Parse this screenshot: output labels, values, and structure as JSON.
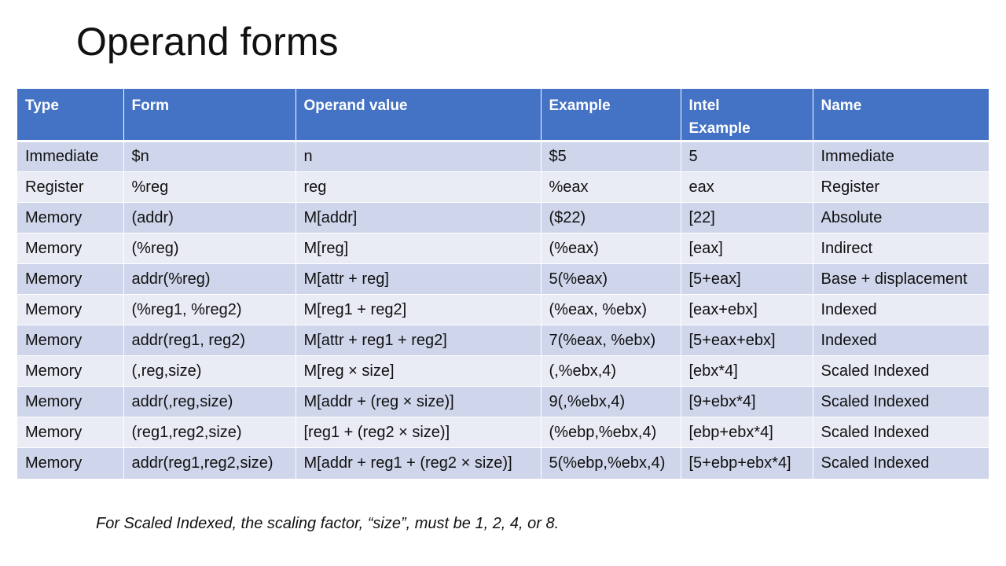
{
  "slide": {
    "title": "Operand forms",
    "footnote": "For Scaled Indexed, the scaling factor, “size”, must be 1, 2, 4, or 8."
  },
  "table": {
    "headers": [
      "Type",
      "Form",
      "Operand value",
      "Example",
      "Intel\nExample",
      "Name"
    ],
    "rows": [
      [
        "Immediate",
        "$n",
        "n",
        "$5",
        "5",
        "Immediate"
      ],
      [
        "Register",
        "%reg",
        "reg",
        "%eax",
        "eax",
        "Register"
      ],
      [
        "Memory",
        "(addr)",
        "M[addr]",
        "($22)",
        "[22]",
        "Absolute"
      ],
      [
        "Memory",
        "(%reg)",
        "M[reg]",
        "(%eax)",
        "[eax]",
        "Indirect"
      ],
      [
        "Memory",
        "addr(%reg)",
        "M[attr + reg]",
        "5(%eax)",
        "[5+eax]",
        "Base + displacement"
      ],
      [
        "Memory",
        "(%reg1, %reg2)",
        "M[reg1 + reg2]",
        "(%eax, %ebx)",
        "[eax+ebx]",
        "Indexed"
      ],
      [
        "Memory",
        "addr(reg1, reg2)",
        "M[attr + reg1 + reg2]",
        "7(%eax, %ebx)",
        "[5+eax+ebx]",
        "Indexed"
      ],
      [
        "Memory",
        "(,reg,size)",
        "M[reg × size]",
        "(,%ebx,4)",
        "[ebx*4]",
        "Scaled Indexed"
      ],
      [
        "Memory",
        "addr(,reg,size)",
        "M[addr + (reg × size)]",
        "9(,%ebx,4)",
        "[9+ebx*4]",
        "Scaled Indexed"
      ],
      [
        "Memory",
        "(reg1,reg2,size)",
        "[reg1 + (reg2 × size)]",
        "(%ebp,%ebx,4)",
        "[ebp+ebx*4]",
        "Scaled Indexed"
      ],
      [
        "Memory",
        "addr(reg1,reg2,size)",
        "M[addr + reg1 + (reg2 × size)]",
        "5(%ebp,%ebx,4)",
        "[5+ebp+ebx*4]",
        "Scaled Indexed"
      ]
    ]
  },
  "colors": {
    "header_bg": "#4472c4",
    "row_odd_bg": "#cfd5ea",
    "row_even_bg": "#e9ebf5"
  }
}
